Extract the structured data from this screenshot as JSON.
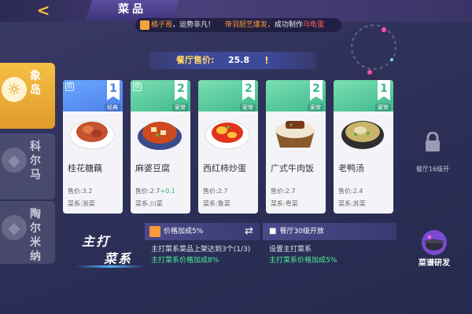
{
  "header": {
    "title": "菜品"
  },
  "ticker": {
    "player": "橘子哥",
    "suffix": "，运势非凡！",
    "part1": "帝羽厨艺爆发，",
    "part2": "成功制作",
    "dish": "乌龟蛋"
  },
  "price": {
    "label": "餐厅售价:",
    "value": "25.8",
    "info_glyph": "!"
  },
  "sidebar": {
    "items": [
      {
        "label": "象岛",
        "active": true
      },
      {
        "label": "科尔马",
        "active": false
      },
      {
        "label": "陶尔米纳",
        "active": false
      }
    ]
  },
  "cards": [
    {
      "name": "桂花糖藕",
      "level": "1",
      "level_unit": "级",
      "tag": "经典",
      "badge": "供",
      "price_label": "售价:",
      "price": "3.2",
      "bonus": "",
      "cuisine": "菜系:浙菜",
      "theme": "blue"
    },
    {
      "name": "麻婆豆腐",
      "level": "2",
      "level_unit": "级",
      "tag": "家常",
      "badge": "供",
      "price_label": "售价:",
      "price": "2.7",
      "bonus": "+0.1",
      "cuisine": "菜系:川菜",
      "theme": "green"
    },
    {
      "name": "西红柿炒蛋",
      "level": "2",
      "level_unit": "级",
      "tag": "家常",
      "badge": "",
      "price_label": "售价:",
      "price": "2.7",
      "bonus": "",
      "cuisine": "菜系:鲁菜",
      "theme": "green"
    },
    {
      "name": "广式牛肉饭",
      "level": "2",
      "level_unit": "级",
      "tag": "家常",
      "badge": "",
      "price_label": "售价:",
      "price": "2.7",
      "bonus": "",
      "cuisine": "菜系:粤菜",
      "theme": "green"
    },
    {
      "name": "老鸭汤",
      "level": "1",
      "level_unit": "级",
      "tag": "家常",
      "badge": "",
      "price_label": "售价:",
      "price": "2.4",
      "bonus": "",
      "cuisine": "菜系:苏菜",
      "theme": "green"
    }
  ],
  "locked_slot": {
    "text": "餐厅16级开"
  },
  "signature": {
    "line1": "主打",
    "line2": "菜系"
  },
  "bonus_panel": {
    "header": "价格加成5%",
    "line1": "主打菜系菜品上架达到3个(1/3)",
    "line2": "主打菜系价格加成8%"
  },
  "locked_panel": {
    "header": "餐厅30级开放",
    "line1": "设置主打菜系",
    "line2": "主打菜系价格加成5%"
  },
  "research": {
    "label": "菜谱研发"
  },
  "colors": {
    "accent": "#f5c046",
    "blue_card": "#4d7fe8",
    "green_card": "#3fb88e",
    "bonus_green": "#4ef09a"
  }
}
